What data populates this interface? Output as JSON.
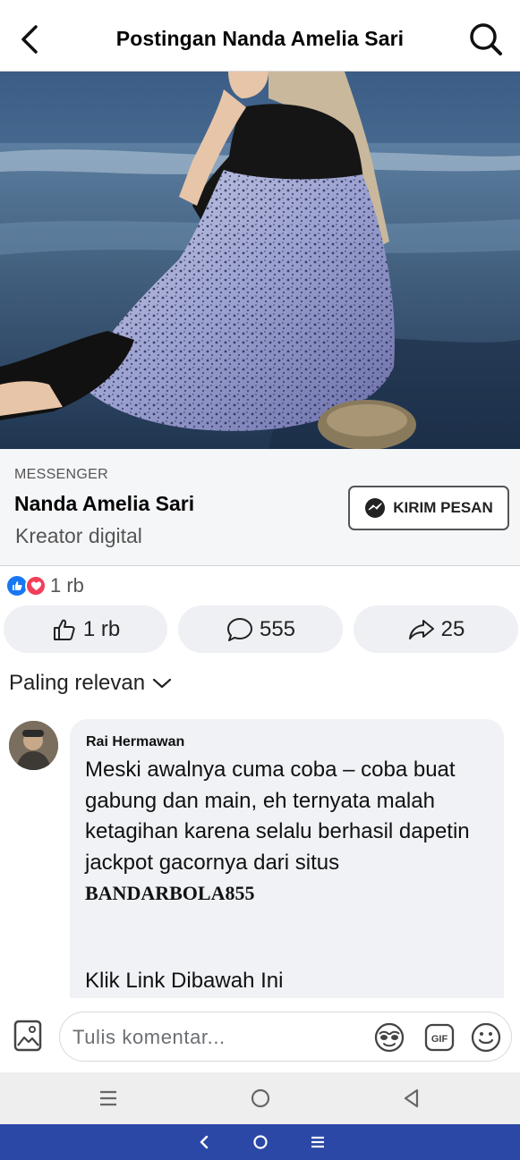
{
  "header": {
    "title": "Postingan Nanda Amelia Sari"
  },
  "sponsor": {
    "label": "MESSENGER",
    "name": "Nanda Amelia Sari",
    "subtitle": "Kreator digital",
    "cta_label": "KIRIM PESAN"
  },
  "reactions": {
    "total": "1 rb",
    "like_color": "#1877f2",
    "love_color": "#f33e58"
  },
  "actions": {
    "like_count": "1 rb",
    "comment_count": "555",
    "share_count": "25"
  },
  "sort": {
    "label": "Paling relevan"
  },
  "comment": {
    "author": "Rai Hermawan",
    "text": "Meski awalnya cuma coba – coba buat gabung dan main, eh ternyata malah ketagihan karena selalu berhasil dapetin jackpot gacornya dari situs",
    "brand": "BANDARBOLA855",
    "link_text": "Klik Link Dibawah Ini"
  },
  "composer": {
    "placeholder": "Tulis komentar...",
    "gif_label": "GIF"
  },
  "colors": {
    "bottom_nav": "#2c48a6",
    "action_pill": "#eef0f3"
  }
}
